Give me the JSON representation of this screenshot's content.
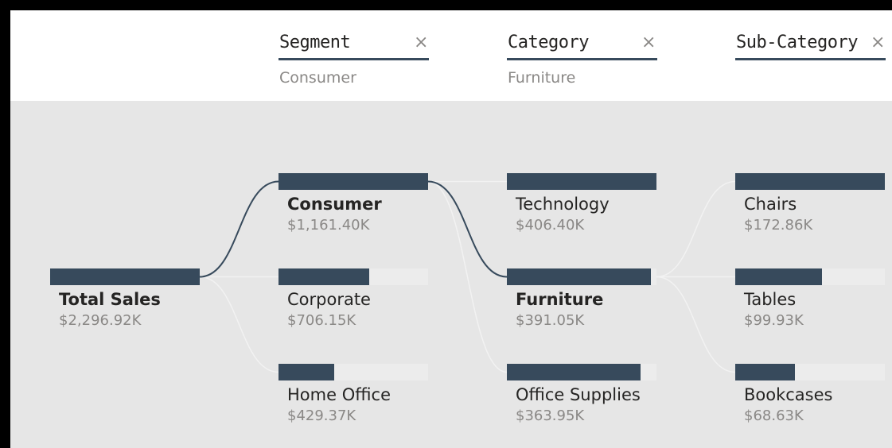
{
  "filters": [
    {
      "title": "Segment",
      "selected": "Consumer",
      "close_icon": "×"
    },
    {
      "title": "Category",
      "selected": "Furniture",
      "close_icon": "×"
    },
    {
      "title": "Sub-Category",
      "selected": "",
      "close_icon": "×"
    }
  ],
  "colors": {
    "bar": "#374a5c",
    "track": "#ececec",
    "active_link": "#374a5c",
    "inactive_link": "#f2f2f2",
    "background": "#e6e6e6"
  },
  "chart_data": {
    "type": "decomposition_tree",
    "unit": "$K",
    "root": {
      "label": "Total Sales",
      "value": 2296.92,
      "display": "$2,296.92K"
    },
    "levels": [
      {
        "name": "Segment",
        "parent": "Total Sales",
        "nodes": [
          {
            "label": "Consumer",
            "value": 1161.4,
            "display": "$1,161.40K",
            "selected": true
          },
          {
            "label": "Corporate",
            "value": 706.15,
            "display": "$706.15K",
            "selected": false
          },
          {
            "label": "Home Office",
            "value": 429.37,
            "display": "$429.37K",
            "selected": false
          }
        ]
      },
      {
        "name": "Category",
        "parent": "Consumer",
        "nodes": [
          {
            "label": "Technology",
            "value": 406.4,
            "display": "$406.40K",
            "selected": false
          },
          {
            "label": "Furniture",
            "value": 391.05,
            "display": "$391.05K",
            "selected": true
          },
          {
            "label": "Office Supplies",
            "value": 363.95,
            "display": "$363.95K",
            "selected": false
          }
        ]
      },
      {
        "name": "Sub-Category",
        "parent": "Furniture",
        "nodes": [
          {
            "label": "Chairs",
            "value": 172.86,
            "display": "$172.86K",
            "selected": false
          },
          {
            "label": "Tables",
            "value": 99.93,
            "display": "$99.93K",
            "selected": false
          },
          {
            "label": "Bookcases",
            "value": 68.63,
            "display": "$68.63K",
            "selected": false
          }
        ]
      }
    ]
  }
}
